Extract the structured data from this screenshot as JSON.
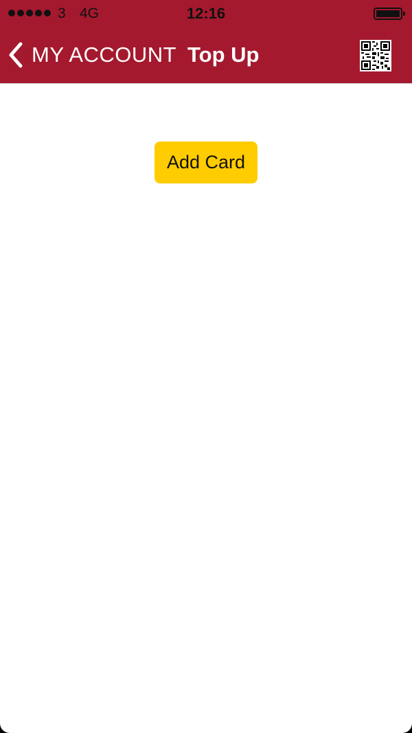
{
  "status_bar": {
    "carrier": "3",
    "network": "4G",
    "time": "12:16",
    "signal_bars": 5,
    "battery_level": 1.0
  },
  "nav": {
    "back_label": "MY ACCOUNT",
    "title": "Top Up",
    "back_icon": "chevron-left-icon",
    "qr_icon": "qr-code-icon"
  },
  "main": {
    "add_card_label": "Add Card"
  },
  "colors": {
    "header": "#a4192e",
    "button": "#ffcc00",
    "back_text": "#ffffff",
    "background": "#ffffff"
  }
}
